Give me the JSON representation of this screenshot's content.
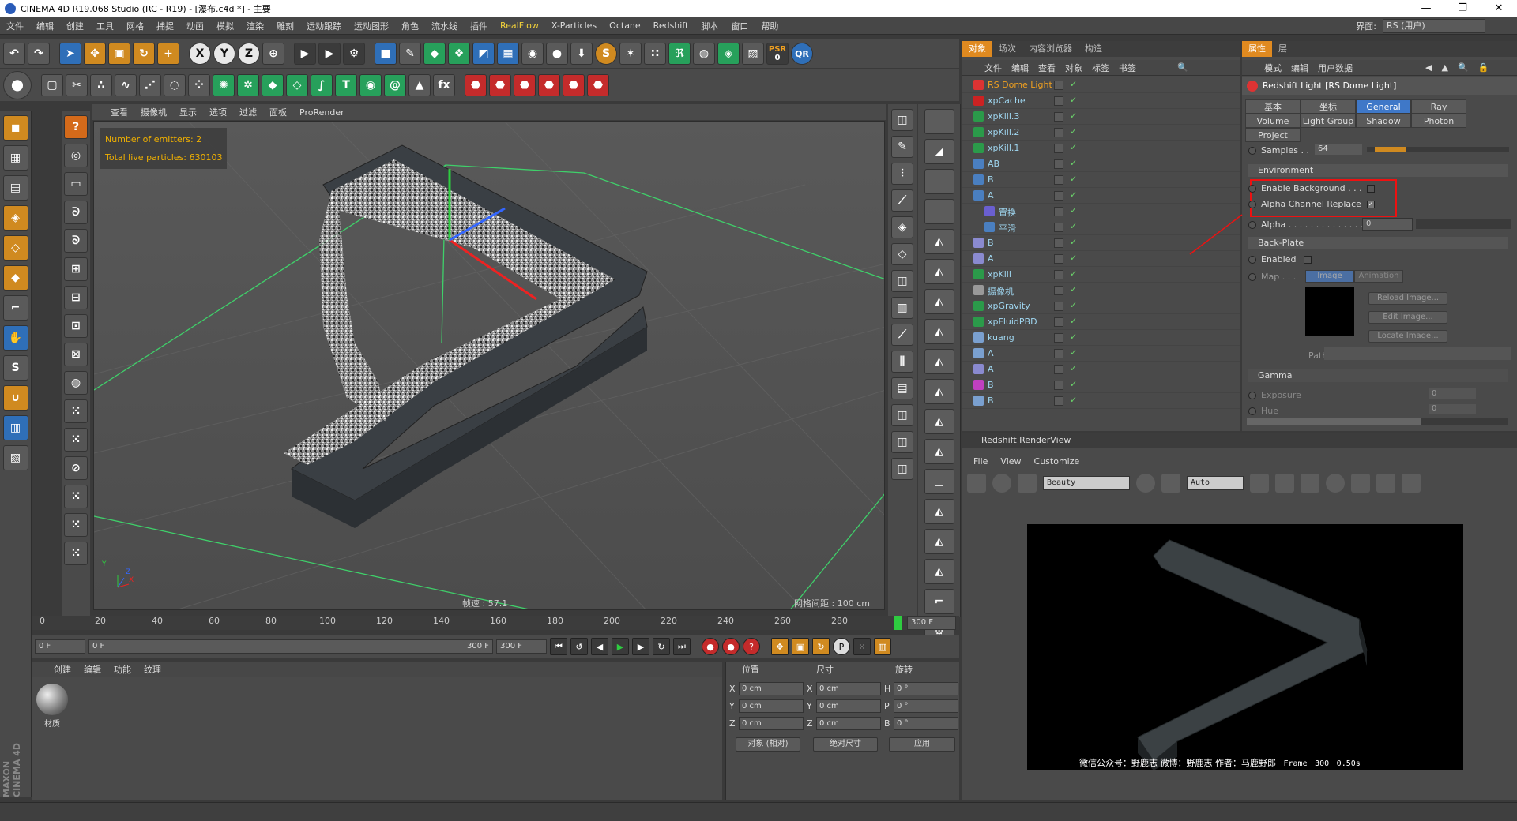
{
  "window": {
    "title": "CINEMA 4D R19.068 Studio (RC - R19) - [瀑布.c4d *] - 主要",
    "min_label": "—",
    "max_label": "❐",
    "close_label": "✕"
  },
  "menu": {
    "items": [
      "文件",
      "编辑",
      "创建",
      "工具",
      "网格",
      "捕捉",
      "动画",
      "模拟",
      "渲染",
      "雕刻",
      "运动跟踪",
      "运动图形",
      "角色",
      "流水线",
      "插件",
      "RealFlow",
      "X-Particles",
      "Octane",
      "Redshift",
      "脚本",
      "窗口",
      "帮助"
    ],
    "interface_label": "界面:",
    "interface_value": "RS (用户)"
  },
  "toolbar": {
    "axis_x": "X",
    "axis_y": "Y",
    "axis_z": "Z",
    "psr_label": "PSR",
    "psr_value": "0",
    "qr_label": "QR",
    "s_label": "S"
  },
  "viewport": {
    "menu": [
      "查看",
      "摄像机",
      "显示",
      "选项",
      "过滤",
      "面板",
      "ProRender"
    ],
    "hud_emitters": "Number of emitters: 2",
    "hud_particles": "Total live particles: 630103",
    "fps": "帧速 : 57.1",
    "grid_spacing": "网格间距 : 100 cm",
    "axis_x": "X",
    "axis_y": "Y",
    "axis_z": "Z"
  },
  "timeline": {
    "ticks": [
      "0",
      "20",
      "40",
      "60",
      "80",
      "100",
      "120",
      "140",
      "160",
      "180",
      "200",
      "220",
      "240",
      "260",
      "280"
    ],
    "current_frame_right": "300 F",
    "start_field": "0 F",
    "range_start": "0 F",
    "range_end": "300 F",
    "end_field": "300 F"
  },
  "material_manager": {
    "menu": [
      "创建",
      "编辑",
      "功能",
      "纹理"
    ],
    "material_name": "材质"
  },
  "coordinates": {
    "headers": [
      "位置",
      "尺寸",
      "旋转"
    ],
    "rows": [
      {
        "axis": "X",
        "pos": "0 cm",
        "size_axis": "X",
        "size": "0 cm",
        "rot_axis": "H",
        "rot": "0 °"
      },
      {
        "axis": "Y",
        "pos": "0 cm",
        "size_axis": "Y",
        "size": "0 cm",
        "rot_axis": "P",
        "rot": "0 °"
      },
      {
        "axis": "Z",
        "pos": "0 cm",
        "size_axis": "Z",
        "size": "0 cm",
        "rot_axis": "B",
        "rot": "0 °"
      }
    ],
    "mode_select": "对象 (相对)",
    "size_select": "绝对尺寸",
    "apply_button": "应用"
  },
  "brand": "MAXON CINEMA 4D",
  "object_manager": {
    "tabs": [
      "对象",
      "场次",
      "内容浏览器",
      "构造"
    ],
    "menu": [
      "文件",
      "编辑",
      "查看",
      "对象",
      "标签",
      "书签"
    ],
    "objects": [
      {
        "name": "RS Dome Light",
        "selected": true,
        "indent": 0,
        "icon_color": "#d33"
      },
      {
        "name": "xpCache",
        "selected": false,
        "indent": 0,
        "icon_color": "#c22"
      },
      {
        "name": "xpKill.3",
        "selected": false,
        "indent": 0,
        "icon_color": "#2b9a4a"
      },
      {
        "name": "xpKill.2",
        "selected": false,
        "indent": 0,
        "icon_color": "#2b9a4a"
      },
      {
        "name": "xpKill.1",
        "selected": false,
        "indent": 0,
        "icon_color": "#2b9a4a"
      },
      {
        "name": "AB",
        "selected": false,
        "indent": 0,
        "icon_color": "#4a7fc0"
      },
      {
        "name": "B",
        "selected": false,
        "indent": 0,
        "icon_color": "#4a7fc0"
      },
      {
        "name": "A",
        "selected": false,
        "indent": 0,
        "icon_color": "#4a7fc0"
      },
      {
        "name": "置换",
        "selected": false,
        "indent": 1,
        "icon_color": "#6a5fd0"
      },
      {
        "name": "平滑",
        "selected": false,
        "indent": 1,
        "icon_color": "#4a7fc0"
      },
      {
        "name": "B",
        "selected": false,
        "indent": 0,
        "icon_color": "#8a8ad0"
      },
      {
        "name": "A",
        "selected": false,
        "indent": 0,
        "icon_color": "#8a8ad0"
      },
      {
        "name": "xpKill",
        "selected": false,
        "indent": 0,
        "icon_color": "#2b9a4a"
      },
      {
        "name": "摄像机",
        "selected": false,
        "indent": 0,
        "icon_color": "#999"
      },
      {
        "name": "xpGravity",
        "selected": false,
        "indent": 0,
        "icon_color": "#2b9a4a"
      },
      {
        "name": "xpFluidPBD",
        "selected": false,
        "indent": 0,
        "icon_color": "#2b9a4a"
      },
      {
        "name": "kuang",
        "selected": false,
        "indent": 0,
        "icon_color": "#7aa0d0"
      },
      {
        "name": "A",
        "selected": false,
        "indent": 0,
        "icon_color": "#7aa0d0"
      },
      {
        "name": "A",
        "selected": false,
        "indent": 0,
        "icon_color": "#8a8ad0"
      },
      {
        "name": "B",
        "selected": false,
        "indent": 0,
        "icon_color": "#c040c0"
      },
      {
        "name": "B",
        "selected": false,
        "indent": 0,
        "icon_color": "#7aa0d0"
      }
    ]
  },
  "attributes": {
    "tabs": [
      "属性",
      "层"
    ],
    "menu": [
      "模式",
      "编辑",
      "用户数据"
    ],
    "object_title": "Redshift Light [RS Dome Light]",
    "subtabs": [
      "基本",
      "坐标",
      "General",
      "Ray",
      "Volume",
      "Light Group",
      "Shadow",
      "Photon",
      "Project"
    ],
    "active_subtab": "General",
    "samples_label": "Samples . .",
    "samples_value": "64",
    "environment_section": "Environment",
    "enable_background": "Enable Background . . .",
    "alpha_channel_replace": "Alpha Channel Replace",
    "alpha_label": "Alpha . . . . . . . . . . . . . .",
    "alpha_value": "0",
    "backplate_section": "Back-Plate",
    "enabled_label": "Enabled",
    "map_label": "Map . . .",
    "image_tab": "Image",
    "animation_tab": "Animation",
    "reload_btn": "Reload Image...",
    "edit_btn": "Edit Image...",
    "locate_btn": "Locate Image...",
    "path_label": "Path",
    "gamma_section": "Gamma",
    "exposure_label": "Exposure",
    "exposure_value": "0",
    "hue_label": "Hue",
    "hue_value": "0"
  },
  "renderview": {
    "title": "Redshift RenderView",
    "menu": [
      "File",
      "View",
      "Customize"
    ],
    "aov_select": "Beauty",
    "zoom_select": "Auto",
    "caption": "微信公众号：野鹿志  微博：野鹿志  作者：马鹿野郎",
    "frame_label": "Frame",
    "frame_value": "300",
    "time_value": "0.50s"
  }
}
